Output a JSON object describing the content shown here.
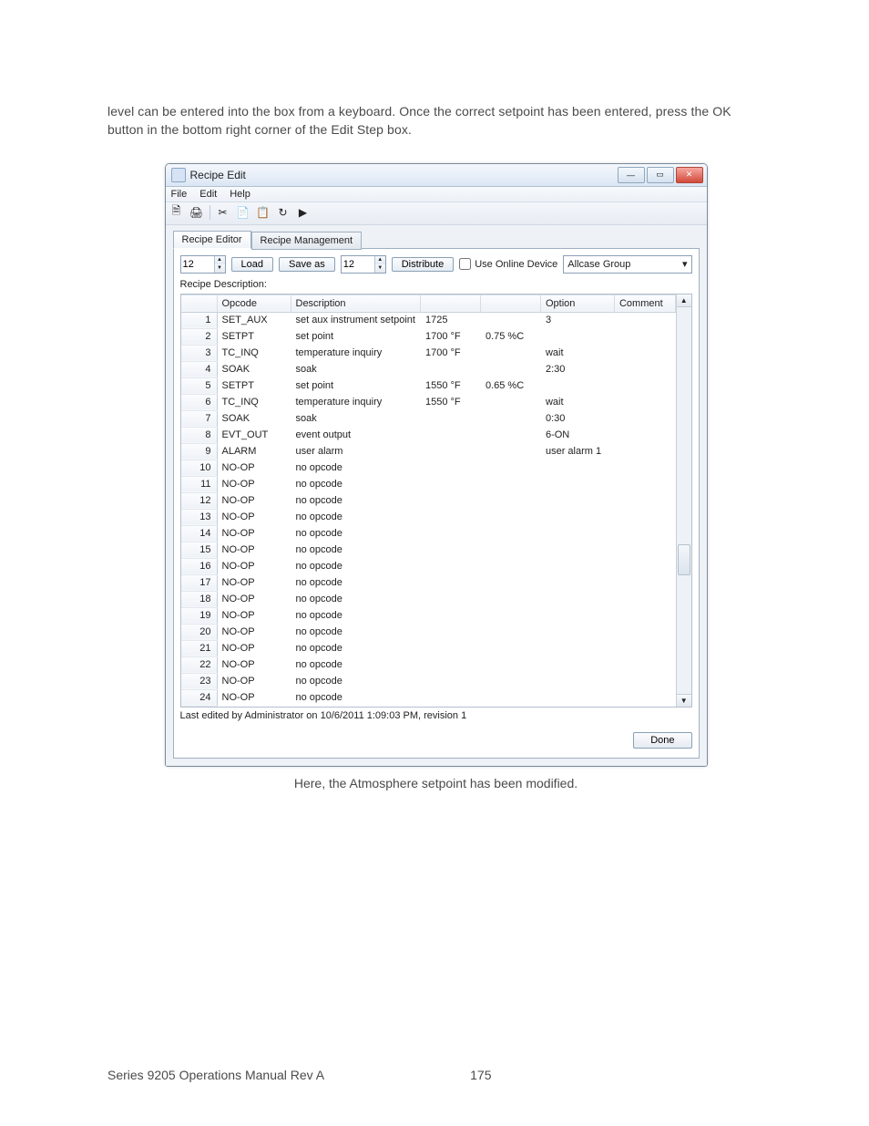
{
  "body_text_1": "level can be entered into the box from a keyboard. Once the correct setpoint has been entered, press the OK button in the bottom right corner of the Edit Step box.",
  "window": {
    "title": "Recipe Edit",
    "menu": [
      "File",
      "Edit",
      "Help"
    ],
    "tabs": {
      "active": "Recipe Editor",
      "inactive": "Recipe Management"
    },
    "controls": {
      "left_num": "12",
      "load": "Load",
      "saveas": "Save as",
      "right_num": "12",
      "distribute": "Distribute",
      "use_online": "Use Online Device",
      "group": "Allcase Group"
    },
    "desc_label": "Recipe Description:",
    "columns": [
      "",
      "Opcode",
      "Description",
      "",
      "",
      "Option",
      "Comment"
    ],
    "rows": [
      {
        "n": "1",
        "op": "SET_AUX",
        "desc": "set aux instrument setpoint",
        "v1": "1725",
        "v2": "",
        "opt": "3",
        "c": ""
      },
      {
        "n": "2",
        "op": "SETPT",
        "desc": "set point",
        "v1": "1700 °F",
        "v2": "0.75 %C",
        "opt": "",
        "c": ""
      },
      {
        "n": "3",
        "op": "TC_INQ",
        "desc": "temperature inquiry",
        "v1": "1700 °F",
        "v2": "",
        "opt": "wait",
        "c": ""
      },
      {
        "n": "4",
        "op": "SOAK",
        "desc": "soak",
        "v1": "",
        "v2": "",
        "opt": "2:30",
        "c": ""
      },
      {
        "n": "5",
        "op": "SETPT",
        "desc": "set point",
        "v1": "1550 °F",
        "v2": "0.65 %C",
        "opt": "",
        "c": ""
      },
      {
        "n": "6",
        "op": "TC_INQ",
        "desc": "temperature inquiry",
        "v1": "1550 °F",
        "v2": "",
        "opt": "wait",
        "c": ""
      },
      {
        "n": "7",
        "op": "SOAK",
        "desc": "soak",
        "v1": "",
        "v2": "",
        "opt": "0:30",
        "c": ""
      },
      {
        "n": "8",
        "op": "EVT_OUT",
        "desc": "event output",
        "v1": "",
        "v2": "",
        "opt": "6-ON",
        "c": ""
      },
      {
        "n": "9",
        "op": "ALARM",
        "desc": "user alarm",
        "v1": "",
        "v2": "",
        "opt": "user alarm 1",
        "c": ""
      },
      {
        "n": "10",
        "op": "NO-OP",
        "desc": "no opcode",
        "v1": "",
        "v2": "",
        "opt": "",
        "c": ""
      },
      {
        "n": "11",
        "op": "NO-OP",
        "desc": "no opcode",
        "v1": "",
        "v2": "",
        "opt": "",
        "c": ""
      },
      {
        "n": "12",
        "op": "NO-OP",
        "desc": "no opcode",
        "v1": "",
        "v2": "",
        "opt": "",
        "c": ""
      },
      {
        "n": "13",
        "op": "NO-OP",
        "desc": "no opcode",
        "v1": "",
        "v2": "",
        "opt": "",
        "c": ""
      },
      {
        "n": "14",
        "op": "NO-OP",
        "desc": "no opcode",
        "v1": "",
        "v2": "",
        "opt": "",
        "c": ""
      },
      {
        "n": "15",
        "op": "NO-OP",
        "desc": "no opcode",
        "v1": "",
        "v2": "",
        "opt": "",
        "c": ""
      },
      {
        "n": "16",
        "op": "NO-OP",
        "desc": "no opcode",
        "v1": "",
        "v2": "",
        "opt": "",
        "c": ""
      },
      {
        "n": "17",
        "op": "NO-OP",
        "desc": "no opcode",
        "v1": "",
        "v2": "",
        "opt": "",
        "c": ""
      },
      {
        "n": "18",
        "op": "NO-OP",
        "desc": "no opcode",
        "v1": "",
        "v2": "",
        "opt": "",
        "c": ""
      },
      {
        "n": "19",
        "op": "NO-OP",
        "desc": "no opcode",
        "v1": "",
        "v2": "",
        "opt": "",
        "c": ""
      },
      {
        "n": "20",
        "op": "NO-OP",
        "desc": "no opcode",
        "v1": "",
        "v2": "",
        "opt": "",
        "c": ""
      },
      {
        "n": "21",
        "op": "NO-OP",
        "desc": "no opcode",
        "v1": "",
        "v2": "",
        "opt": "",
        "c": ""
      },
      {
        "n": "22",
        "op": "NO-OP",
        "desc": "no opcode",
        "v1": "",
        "v2": "",
        "opt": "",
        "c": ""
      },
      {
        "n": "23",
        "op": "NO-OP",
        "desc": "no opcode",
        "v1": "",
        "v2": "",
        "opt": "",
        "c": ""
      },
      {
        "n": "24",
        "op": "NO-OP",
        "desc": "no opcode",
        "v1": "",
        "v2": "",
        "opt": "",
        "c": ""
      }
    ],
    "last_edited": "Last edited by Administrator on 10/6/2011 1:09:03 PM, revision 1",
    "done": "Done"
  },
  "caption": "Here, the Atmosphere setpoint has been modified.",
  "footer_left": "Series 9205 Operations Manual Rev A",
  "footer_page": "175"
}
